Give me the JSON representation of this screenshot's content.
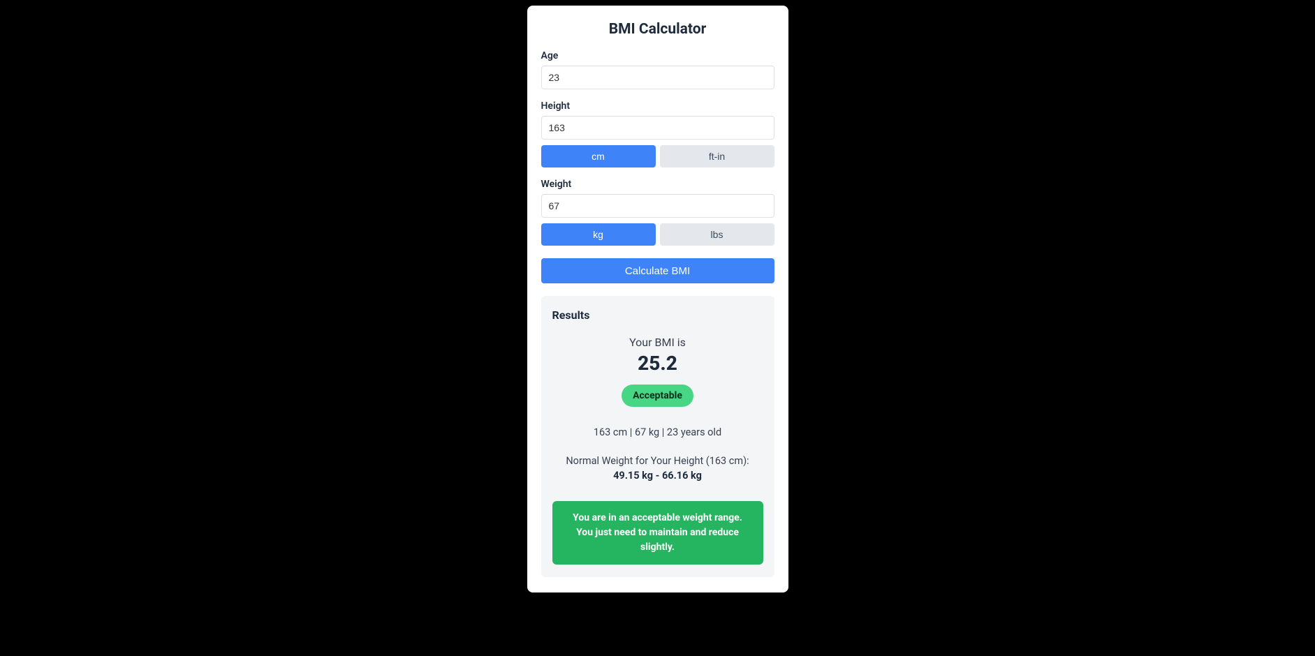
{
  "title": "BMI Calculator",
  "age": {
    "label": "Age",
    "value": "23"
  },
  "height": {
    "label": "Height",
    "value": "163",
    "units": {
      "cm": "cm",
      "ftin": "ft-in",
      "active": "cm"
    }
  },
  "weight": {
    "label": "Weight",
    "value": "67",
    "units": {
      "kg": "kg",
      "lbs": "lbs",
      "active": "kg"
    }
  },
  "calculate": "Calculate BMI",
  "results": {
    "heading": "Results",
    "intro": "Your BMI is",
    "bmi": "25.2",
    "status": "Acceptable",
    "summary": "163 cm | 67 kg | 23 years old",
    "normal_label": "Normal Weight for Your Height (163 cm):",
    "normal_range": "49.15 kg - 66.16 kg",
    "advice": "You are in an acceptable weight range. You just need to maintain and reduce slightly."
  }
}
